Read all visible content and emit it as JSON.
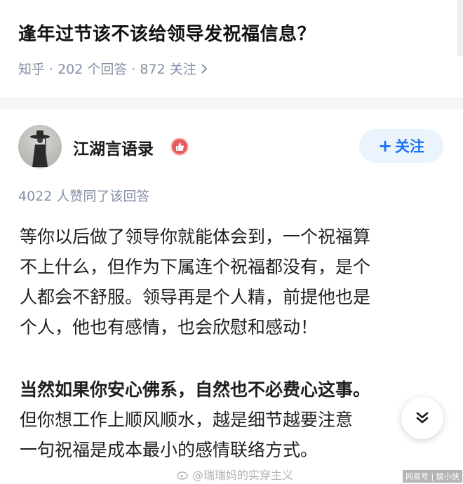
{
  "question": {
    "title": "逢年过节该不该给领导发祝福信息？",
    "source": "知乎",
    "answers": "202 个回答",
    "followers": "872 关注",
    "separator": "·"
  },
  "answer": {
    "author": "江湖言语录",
    "follow_label": "关注",
    "agree_text": "4022 人赞同了该回答",
    "paragraph1": [
      "等你以后做了领导你就能体会到，一个祝福算",
      "不上什么，但作为下属连个祝福都没有，是个",
      "人都会不舒服。领导再是个人精，前提他也是",
      "个人，他也有感情，也会欣慰和感动！"
    ],
    "paragraph2": [
      "当然如果你安心佛系，自然也不必费心这事。",
      "但你想工作上顺风顺水，越是细节越要注意",
      "一句祝福是成本最小的感情联络方式。"
    ]
  },
  "watermark": {
    "text": "@瑞瑞妈的实穿主义",
    "corner": "网易号 | 娱小侠"
  },
  "icons": {
    "meta_chevron": "chevron-right-icon",
    "scroll_button": "double-chevron-down-icon",
    "badge": "thumb-badge-icon"
  },
  "colors": {
    "accent": "#1772f6",
    "meta_gray": "#8590a6",
    "badge_red": "#e85b5b"
  }
}
